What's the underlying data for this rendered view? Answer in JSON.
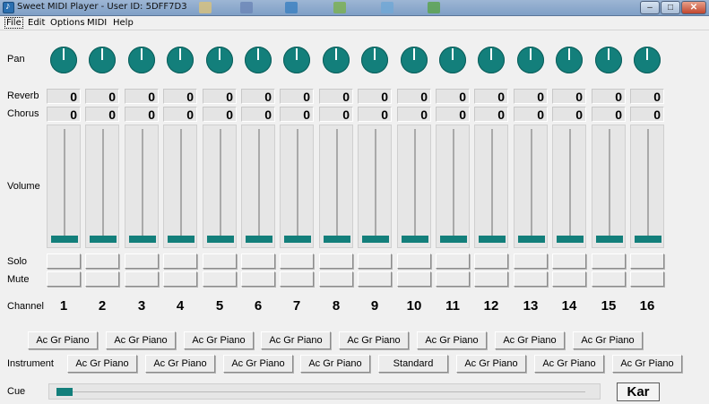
{
  "window": {
    "title": "Sweet MIDI Player - User ID: 5DFF7D3",
    "controls": {
      "minimize": "–",
      "maximize": "□",
      "close": "✕"
    }
  },
  "menu": [
    "File",
    "Edit",
    "Options",
    "MIDI",
    "Help"
  ],
  "labels": {
    "pan": "Pan",
    "reverb": "Reverb",
    "chorus": "Chorus",
    "volume": "Volume",
    "solo": "Solo",
    "mute": "Mute",
    "channel": "Channel",
    "instrument": "Instrument",
    "cue": "Cue"
  },
  "channels": [
    {
      "number": "1",
      "reverb": "0",
      "chorus": "0",
      "volume_level": 0
    },
    {
      "number": "2",
      "reverb": "0",
      "chorus": "0",
      "volume_level": 0
    },
    {
      "number": "3",
      "reverb": "0",
      "chorus": "0",
      "volume_level": 0
    },
    {
      "number": "4",
      "reverb": "0",
      "chorus": "0",
      "volume_level": 0
    },
    {
      "number": "5",
      "reverb": "0",
      "chorus": "0",
      "volume_level": 0
    },
    {
      "number": "6",
      "reverb": "0",
      "chorus": "0",
      "volume_level": 0
    },
    {
      "number": "7",
      "reverb": "0",
      "chorus": "0",
      "volume_level": 0
    },
    {
      "number": "8",
      "reverb": "0",
      "chorus": "0",
      "volume_level": 0
    },
    {
      "number": "9",
      "reverb": "0",
      "chorus": "0",
      "volume_level": 0
    },
    {
      "number": "10",
      "reverb": "0",
      "chorus": "0",
      "volume_level": 0
    },
    {
      "number": "11",
      "reverb": "0",
      "chorus": "0",
      "volume_level": 0
    },
    {
      "number": "12",
      "reverb": "0",
      "chorus": "0",
      "volume_level": 0
    },
    {
      "number": "13",
      "reverb": "0",
      "chorus": "0",
      "volume_level": 0
    },
    {
      "number": "14",
      "reverb": "0",
      "chorus": "0",
      "volume_level": 0
    },
    {
      "number": "15",
      "reverb": "0",
      "chorus": "0",
      "volume_level": 0
    },
    {
      "number": "16",
      "reverb": "0",
      "chorus": "0",
      "volume_level": 0
    }
  ],
  "instruments_top": [
    "Ac Gr Piano",
    "Ac Gr Piano",
    "Ac Gr Piano",
    "Ac Gr Piano",
    "Ac Gr Piano",
    "Ac Gr Piano",
    "Ac Gr Piano",
    "Ac Gr Piano"
  ],
  "instruments_bottom": [
    "Ac Gr Piano",
    "Ac Gr Piano",
    "Ac Gr Piano",
    "Ac Gr Piano",
    "Standard",
    "Ac Gr Piano",
    "Ac Gr Piano",
    "Ac Gr Piano"
  ],
  "cue_position": 0,
  "kar_label": "Kar",
  "colors": {
    "accent": "#137f7b",
    "background": "#f0f0f0"
  },
  "icons": {
    "app": "music-note-icon",
    "pan": "knob-icon"
  }
}
